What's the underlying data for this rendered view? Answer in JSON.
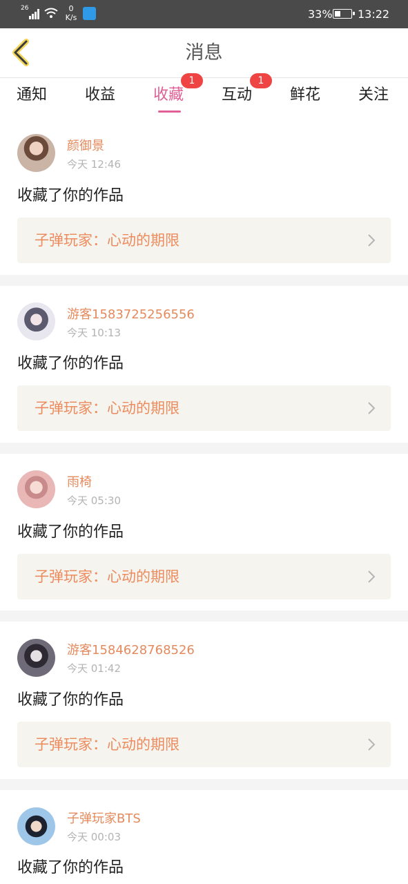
{
  "status_bar": {
    "network": "26",
    "speed_value": "0",
    "speed_unit": "K/s",
    "battery": "33%",
    "time": "13:22"
  },
  "header": {
    "title": "消息",
    "back_icon": "chevron-left-icon"
  },
  "tabs": [
    {
      "label": "通知"
    },
    {
      "label": "收益"
    },
    {
      "label": "收藏",
      "badge": "1",
      "active": true
    },
    {
      "label": "互动",
      "badge": "1"
    },
    {
      "label": "鲜花"
    },
    {
      "label": "关注"
    }
  ],
  "colors": {
    "accent": "#e05f94",
    "username": "#e48a5d",
    "work_title": "#ec8b5e",
    "badge": "#ef4444",
    "work_bg": "#f5f4ee"
  },
  "items": [
    {
      "user": "颜御景",
      "time": "今天 12:46",
      "action": "收藏了你的作品",
      "work": "子弹玩家：心动的期限"
    },
    {
      "user": "游客1583725256556",
      "time": "今天 10:13",
      "action": "收藏了你的作品",
      "work": "子弹玩家：心动的期限"
    },
    {
      "user": "雨椅",
      "time": "今天 05:30",
      "action": "收藏了你的作品",
      "work": "子弹玩家：心动的期限"
    },
    {
      "user": "游客1584628768526",
      "time": "今天 01:42",
      "action": "收藏了你的作品",
      "work": "子弹玩家：心动的期限"
    },
    {
      "user": "子弹玩家BTS",
      "time": "今天 00:03",
      "action": "收藏了你的作品"
    }
  ]
}
